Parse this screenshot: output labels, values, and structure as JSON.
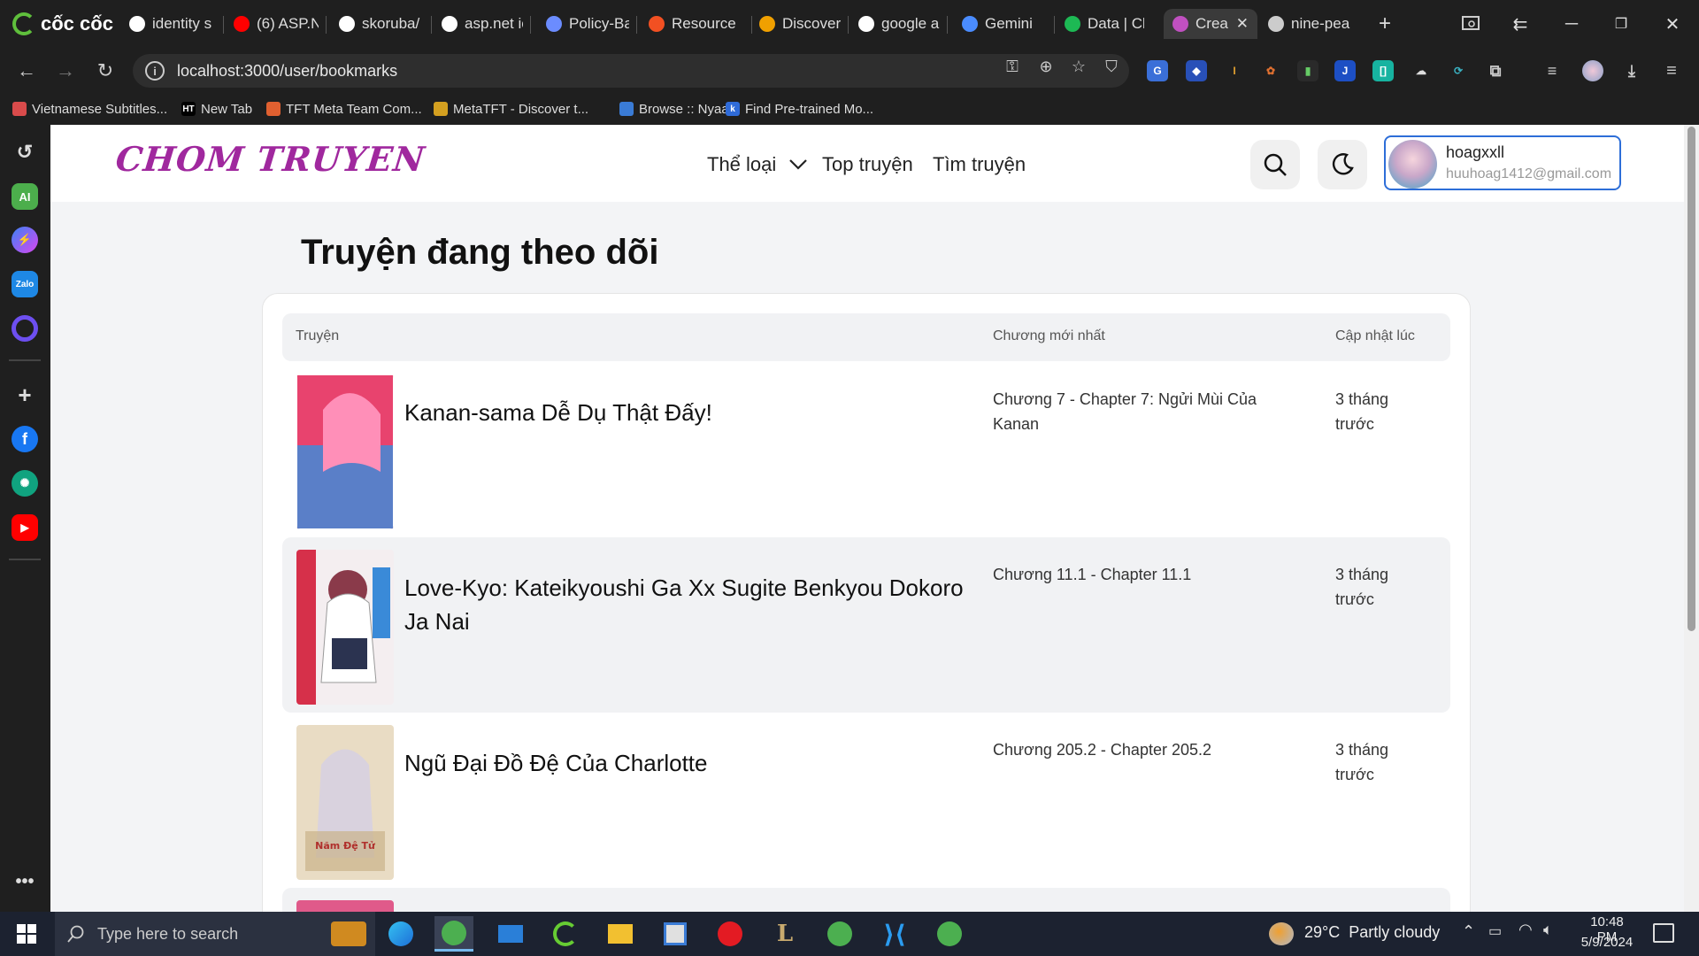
{
  "browser": {
    "brand": "cốc cốc",
    "tabs": [
      {
        "label": "identity s",
        "icon": "google-icon",
        "color": "#ffffff"
      },
      {
        "label": "(6) ASP.N",
        "icon": "youtube-icon",
        "color": "#ff0000"
      },
      {
        "label": "skoruba/",
        "icon": "github-icon",
        "color": "#ffffff"
      },
      {
        "label": "asp.net ic",
        "icon": "google-icon",
        "color": "#ffffff"
      },
      {
        "label": "Policy-Ba",
        "icon": "v-icon",
        "color": "#6b8cff"
      },
      {
        "label": "Resource",
        "icon": "microsoft-icon",
        "color": "#f25022"
      },
      {
        "label": "Discover",
        "icon": "discover-icon",
        "color": "#f0a000"
      },
      {
        "label": "google a",
        "icon": "google-icon",
        "color": "#ffffff"
      },
      {
        "label": "Gemini",
        "icon": "gemini-icon",
        "color": "#4a8cff"
      },
      {
        "label": "Data | Cl",
        "icon": "data-icon",
        "color": "#1db954"
      },
      {
        "label": "Crea",
        "icon": "ct-icon",
        "color": "#c050c0",
        "active": true
      },
      {
        "label": "nine-pea",
        "icon": "globe-icon",
        "color": "#cccccc"
      }
    ],
    "url": "localhost:3000/user/bookmarks",
    "bookmarks": [
      {
        "label": "Vietnamese Subtitles...",
        "color": "#d94b4b"
      },
      {
        "label": "New Tab",
        "color": "#000000",
        "badge": "HT"
      },
      {
        "label": "TFT Meta Team Com...",
        "color": "#e06030"
      },
      {
        "label": "MetaTFT - Discover t...",
        "color": "#d4a020"
      },
      {
        "label": "Browse :: Nyaa",
        "color": "#3a7bd5"
      },
      {
        "label": "Find Pre-trained Mo...",
        "color": "#2f6bd8",
        "badge": "k"
      }
    ]
  },
  "site": {
    "brand": "CHOM TRUYEN",
    "nav": {
      "genre": "Thể loại",
      "top": "Top truyện",
      "search": "Tìm truyện"
    },
    "user": {
      "name": "hoagxxll",
      "email": "huuhoag1412@gmail.com"
    },
    "page_title": "Truyện đang theo dõi",
    "table": {
      "headers": [
        "Truyện",
        "Chương mới nhất",
        "Cập nhật lúc"
      ],
      "rows": [
        {
          "title": "Kanan-sama Dễ Dụ Thật Đấy!",
          "chapter": "Chương 7 - Chapter 7: Ngửi Mùi Của Kanan",
          "updated": "3 tháng trước"
        },
        {
          "title": "Love-Kyo: Kateikyoushi Ga Xx Sugite Benkyou Dokoro Ja Nai",
          "chapter": "Chương 11.1 - Chapter 11.1",
          "updated": "3 tháng trước"
        },
        {
          "title": "Ngũ Đại Đồ Đệ Của Charlotte",
          "chapter": "Chương 205.2 - Chapter 205.2",
          "updated": "3 tháng trước"
        }
      ]
    }
  },
  "taskbar": {
    "search_placeholder": "Type here to search",
    "weather": "29°C  Partly cloudy",
    "time": "10:48 PM",
    "date": "5/9/2024"
  }
}
